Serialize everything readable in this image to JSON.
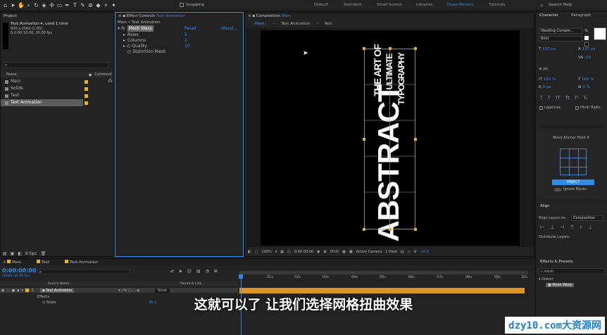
{
  "toolbar": {
    "snapping": "Snapping",
    "workspaces": [
      "Default",
      "Standard",
      "Small Screen",
      "Libraries",
      "Dope Motions",
      "Tutorials"
    ],
    "active_workspace": "Dope Motions",
    "search_help": "Search Help"
  },
  "project": {
    "title": "Project",
    "selected_name": "Text Animation",
    "used": ", used 1 time",
    "dimensions": "600 x 2560 (1.00)",
    "duration": "Δ 0:00:10:00, 30.00 fps",
    "search_placeholder": "",
    "col_name": "Name",
    "col_comment": "Comment",
    "items": [
      "Main",
      "Solids",
      "Text",
      "Text Animation"
    ],
    "bpc": "8 bpc"
  },
  "effect_controls": {
    "title_prefix": "Effect Controls",
    "title_layer": "Text Animation",
    "breadcrumb": "Main • Text Animation",
    "effect_name": "Mesh Warp",
    "reset": "Reset",
    "about": "About...",
    "params": [
      {
        "label": "Rows",
        "value": "5"
      },
      {
        "label": "Columns",
        "value": "2"
      },
      {
        "label": "Quality",
        "value": "10"
      },
      {
        "label": "Distortion Mesh",
        "value": ""
      }
    ]
  },
  "composition": {
    "title_prefix": "Composition",
    "title_name": "Main",
    "tabs": [
      "Main",
      "Text Animation",
      "Text"
    ],
    "bigword": "ABSTRACT",
    "line1": "THE ART OF",
    "line2": "ULTIMATE",
    "line3": "TYPOGRAPHY",
    "zoom": "100%",
    "timecode": "0:00:00:00",
    "resolution": "(Full)",
    "camera": "Active Camera",
    "view": "1 View",
    "exposure": "+0.0"
  },
  "timeline": {
    "tabs": [
      "Main",
      "Text",
      "Text Animation"
    ],
    "timecode": "0:00:00:00",
    "fps_line": "00000 (30.00 fps)",
    "col_source": "Source Name",
    "col_parent": "Parent & Link",
    "layer_number": "1",
    "layer_name": "Text Animation",
    "parent": "None",
    "sub_effects": "Effects",
    "sub_scale": "Scale",
    "scale_value": "35.0",
    "ticks": [
      "0s",
      "01s",
      "02s",
      "03s",
      "04s",
      "05s",
      "06s",
      "07s",
      "08s",
      "09s",
      "10s"
    ]
  },
  "character": {
    "title": "Character",
    "paragraph_tab": "Paragraph",
    "font": "Heading Compre...",
    "style": "Bold",
    "size": "150 px",
    "leading": "137 px",
    "tracking": "-20",
    "px_unit": "px",
    "vscale": "100 %",
    "hscale": "100 %",
    "baseline": "0 px",
    "tsume": "0 %",
    "ligatures": "Ligatures",
    "hindi": "Hindi Digits"
  },
  "anchor": {
    "title": "Move Anchor Point 4",
    "object_btn": "OBJECT",
    "ignore_masks": "Ignore Masks"
  },
  "align": {
    "title": "Align",
    "align_to_label": "Align Layers to:",
    "align_to_value": "Composition",
    "distribute": "Distribute Layers:"
  },
  "effects_presets": {
    "title": "Effects & Presets",
    "search": "mesh",
    "category": "Distort",
    "item": "Mesh Warp"
  },
  "subtitle": "这就可以了 让我们选择网格扭曲效果",
  "watermark": "dzy10.com大资源网",
  "colors": {
    "accent": "#2d8ceb",
    "label_yellow": "#e6b323"
  }
}
